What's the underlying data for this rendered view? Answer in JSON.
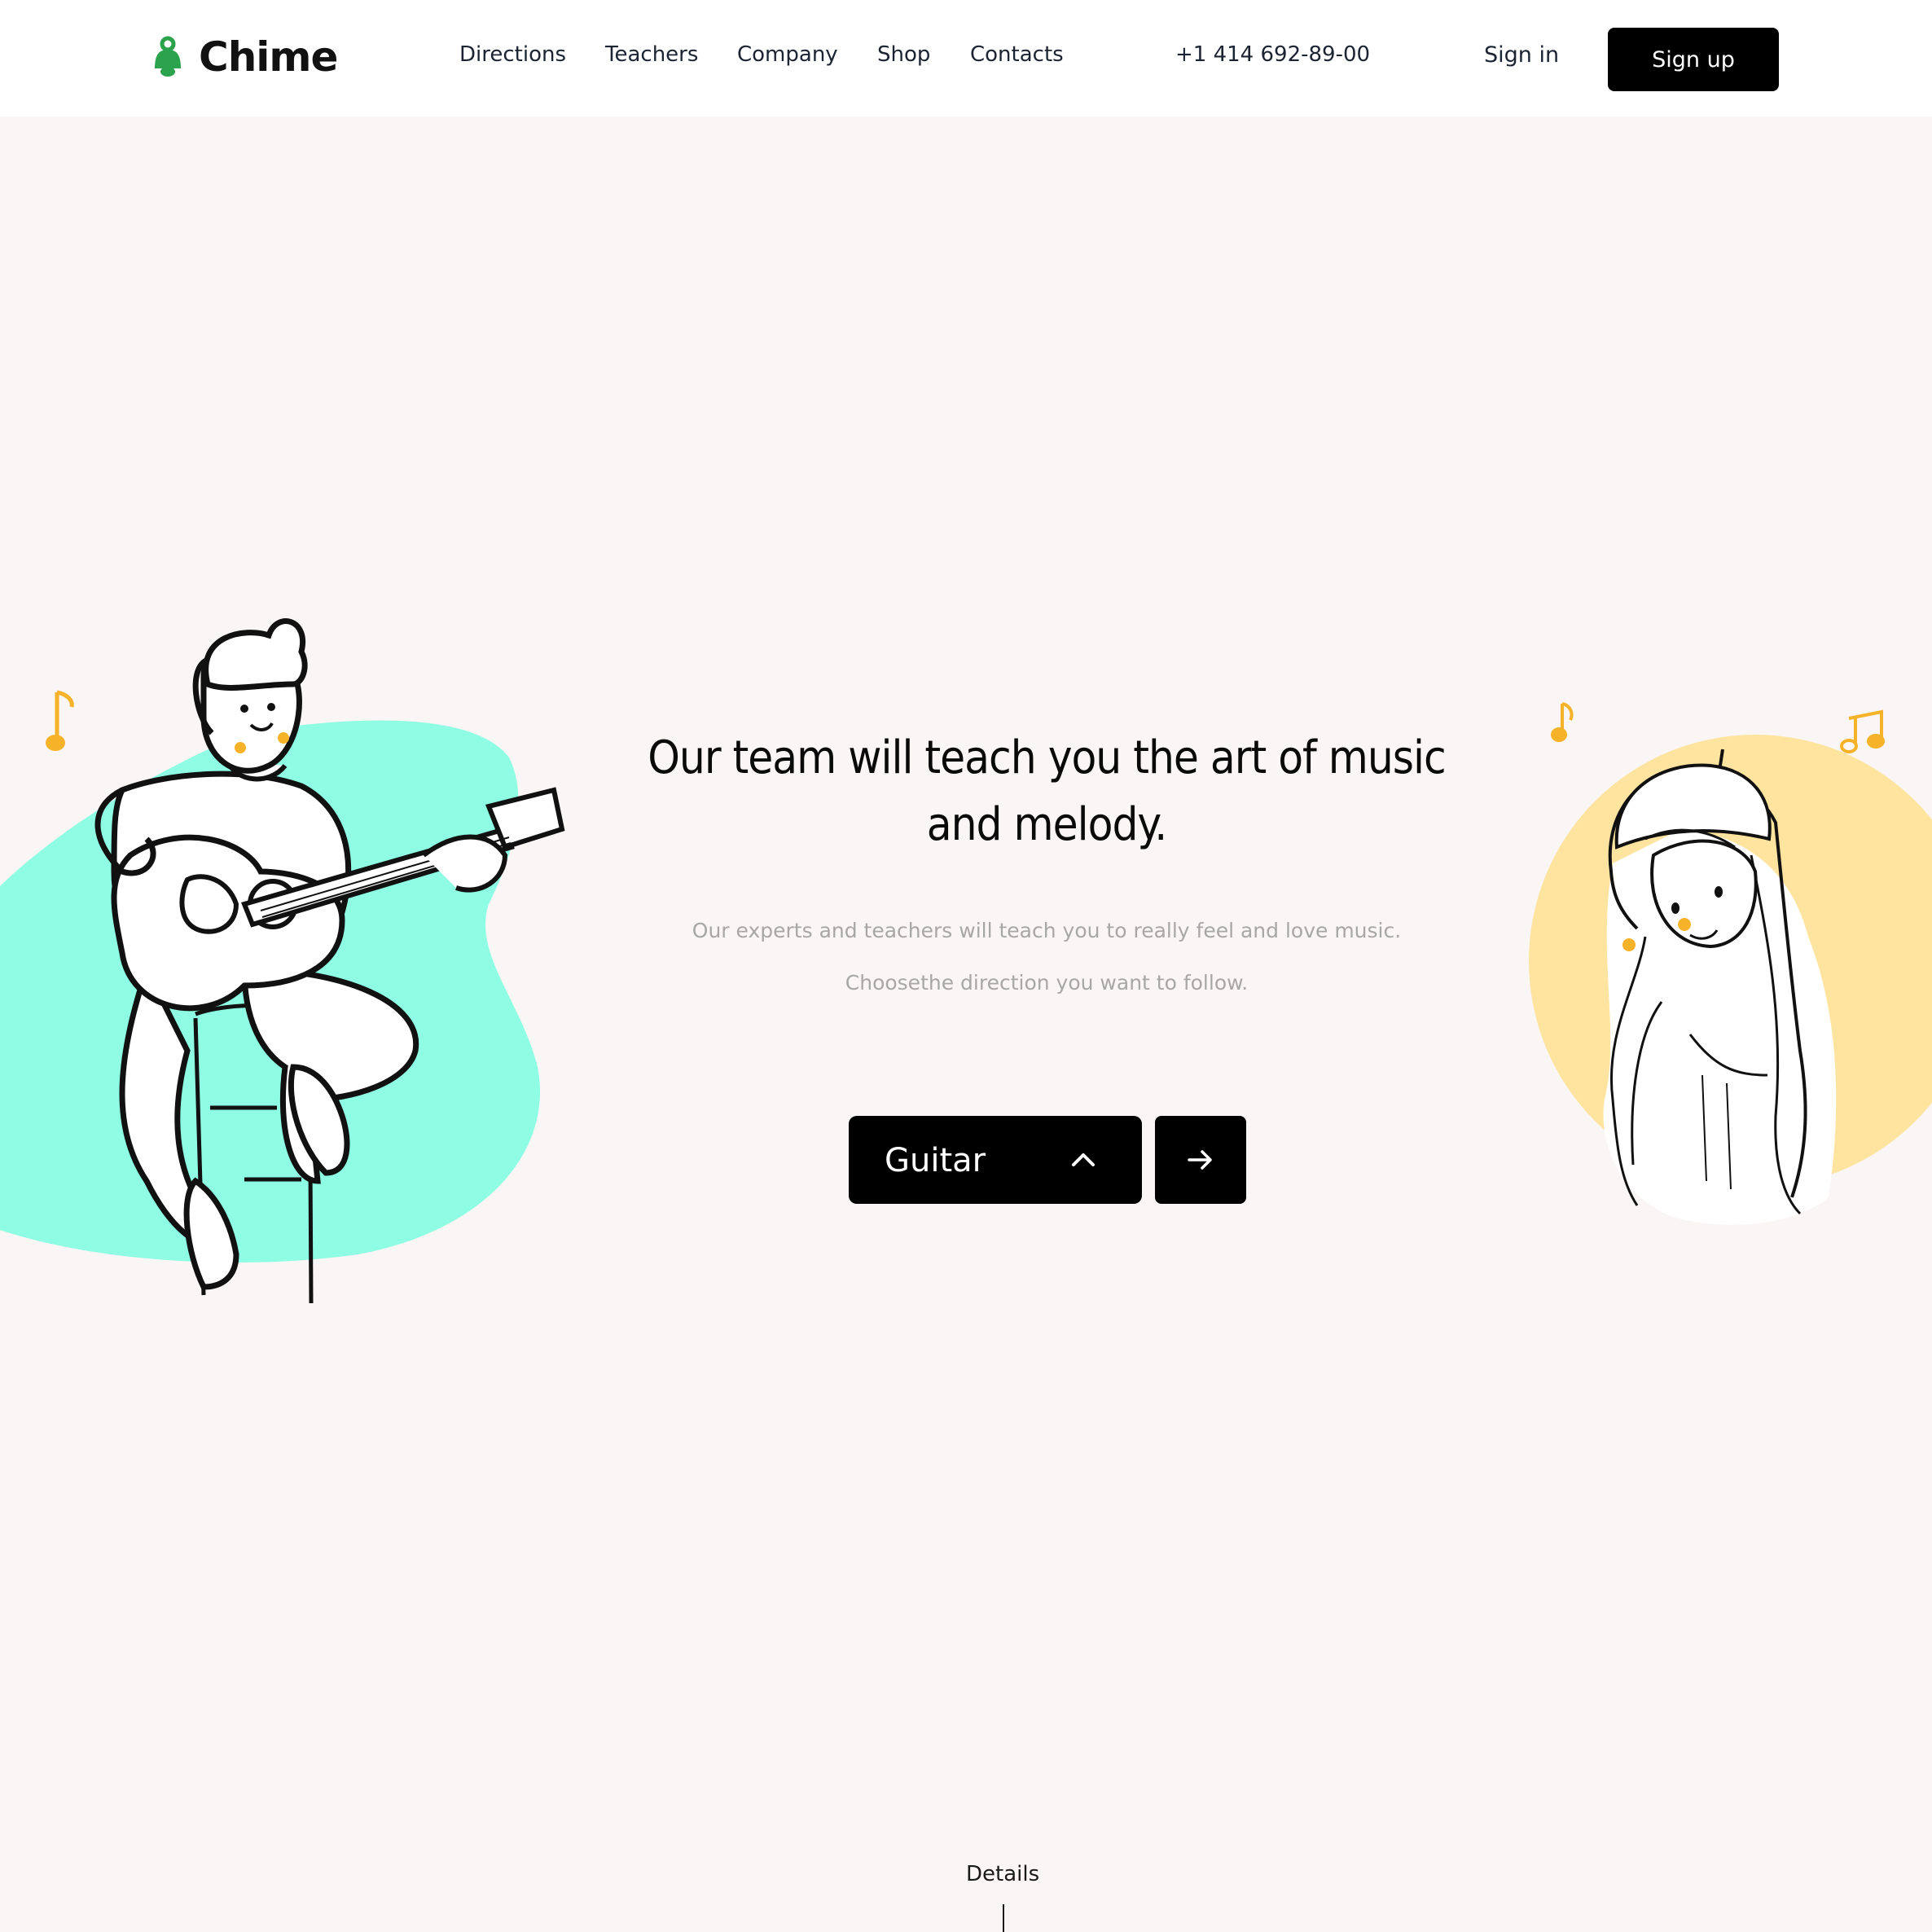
{
  "brand": {
    "name": "Chime",
    "logo_icon": "bell-icon",
    "color": "#2ba24c"
  },
  "nav": {
    "items": [
      {
        "label": "Directions"
      },
      {
        "label": "Teachers"
      },
      {
        "label": "Company"
      },
      {
        "label": "Shop"
      },
      {
        "label": "Contacts"
      }
    ]
  },
  "header": {
    "phone": "+1 414 692-89-00",
    "signin_label": "Sign in",
    "signup_label": "Sign up"
  },
  "hero": {
    "title": "Our team will teach you the art of music and melody.",
    "subtitle_1": "Our experts and teachers will teach you to really feel and love music.",
    "subtitle_2": "Choosethe direction you want to follow.",
    "select_value": "Guitar",
    "select_icon": "chevron-up-icon",
    "go_icon": "arrow-right-icon"
  },
  "footer": {
    "details_label": "Details"
  },
  "colors": {
    "accent_mint": "#8ffde3",
    "accent_yellow": "#ffe49f",
    "note_orange": "#f6b32a",
    "button": "#000000",
    "background": "#f9f6f5"
  }
}
